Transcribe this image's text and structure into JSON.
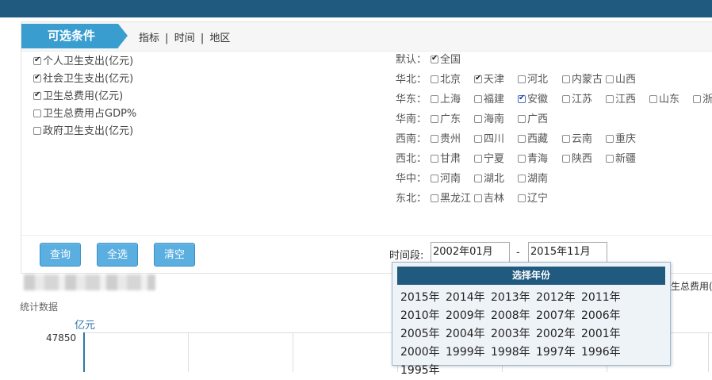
{
  "tabs": {
    "flag": "可选条件",
    "links": [
      "指标",
      "时间",
      "地区"
    ],
    "separator": "|"
  },
  "indicators": [
    {
      "label": "个人卫生支出(亿元)",
      "checked": true
    },
    {
      "label": "社会卫生支出(亿元)",
      "checked": true
    },
    {
      "label": "卫生总费用(亿元)",
      "checked": true
    },
    {
      "label": "卫生总费用占GDP%",
      "checked": false
    },
    {
      "label": "政府卫生支出(亿元)",
      "checked": false
    }
  ],
  "regions": [
    {
      "label": "默认：",
      "items": [
        {
          "name": "全国",
          "checked": true
        }
      ]
    },
    {
      "label": "华北：",
      "items": [
        {
          "name": "北京",
          "checked": false
        },
        {
          "name": "天津",
          "checked": true
        },
        {
          "name": "河北",
          "checked": false
        },
        {
          "name": "内蒙古",
          "checked": false
        },
        {
          "name": "山西",
          "checked": false
        }
      ]
    },
    {
      "label": "华东：",
      "items": [
        {
          "name": "上海",
          "checked": false
        },
        {
          "name": "福建",
          "checked": false
        },
        {
          "name": "安徽",
          "checked": true,
          "focused": true
        },
        {
          "name": "江苏",
          "checked": false
        },
        {
          "name": "江西",
          "checked": false
        },
        {
          "name": "山东",
          "checked": false
        },
        {
          "name": "浙",
          "checked": false
        }
      ]
    },
    {
      "label": "华南：",
      "items": [
        {
          "name": "广东",
          "checked": false
        },
        {
          "name": "海南",
          "checked": false
        },
        {
          "name": "广西",
          "checked": false
        }
      ]
    },
    {
      "label": "西南：",
      "items": [
        {
          "name": "贵州",
          "checked": false
        },
        {
          "name": "四川",
          "checked": false
        },
        {
          "name": "西藏",
          "checked": false
        },
        {
          "name": "云南",
          "checked": false
        },
        {
          "name": "重庆",
          "checked": false
        }
      ]
    },
    {
      "label": "西北：",
      "items": [
        {
          "name": "甘肃",
          "checked": false
        },
        {
          "name": "宁夏",
          "checked": false
        },
        {
          "name": "青海",
          "checked": false
        },
        {
          "name": "陕西",
          "checked": false
        },
        {
          "name": "新疆",
          "checked": false
        }
      ]
    },
    {
      "label": "华中：",
      "items": [
        {
          "name": "河南",
          "checked": false
        },
        {
          "name": "湖北",
          "checked": false
        },
        {
          "name": "湖南",
          "checked": false
        }
      ]
    },
    {
      "label": "东北：",
      "items": [
        {
          "name": "黑龙江",
          "checked": false
        },
        {
          "name": "吉林",
          "checked": false
        },
        {
          "name": "辽宁",
          "checked": false
        }
      ]
    }
  ],
  "buttons": {
    "query": "查询",
    "select_all": "全选",
    "clear": "清空"
  },
  "period": {
    "label": "时间段:",
    "start": "2002年01月",
    "dash": "-",
    "end": "2015年11月"
  },
  "year_picker": {
    "title": "选择年份",
    "years": [
      "2015年",
      "2014年",
      "2013年",
      "2012年",
      "2011年",
      "2010年",
      "2009年",
      "2008年",
      "2007年",
      "2006年",
      "2005年",
      "2004年",
      "2003年",
      "2002年",
      "2001年",
      "2000年",
      "1999年",
      "1998年",
      "1997年",
      "1996年",
      "1995年"
    ]
  },
  "chart": {
    "section_label": "统计数据",
    "unit": "亿元",
    "y_top_tick": "47850",
    "legend_partial": "生总费用(亿"
  },
  "colors": {
    "topbar": "#215a7f",
    "accent": "#3a9dd0",
    "button": "#5aaee0"
  }
}
